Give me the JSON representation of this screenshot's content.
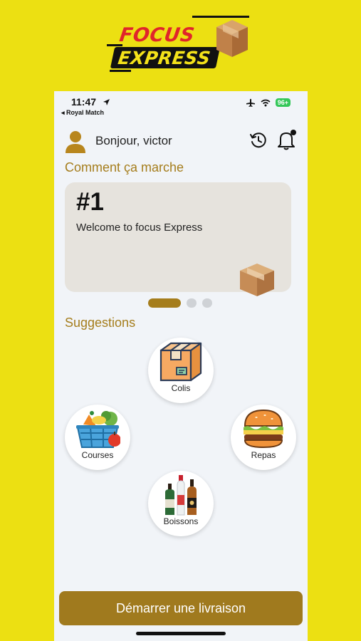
{
  "logo": {
    "line1": "FOCUS",
    "line2": "EXPRESS"
  },
  "status_bar": {
    "time": "11:47",
    "back_app": "◂ Royal Match",
    "battery": "96+"
  },
  "header": {
    "greeting": "Bonjour, victor",
    "icons": [
      "user-avatar-icon",
      "history-icon",
      "notification-bell-icon"
    ]
  },
  "how_it_works": {
    "title": "Comment ça marche",
    "card": {
      "number": "#1",
      "text": "Welcome to focus Express",
      "icon": "package-box-icon"
    },
    "pagination": {
      "pages": 3,
      "active": 0
    }
  },
  "suggestions": {
    "title": "Suggestions",
    "items": [
      {
        "label": "Colis",
        "icon": "package-icon"
      },
      {
        "label": "Courses",
        "icon": "grocery-basket-icon"
      },
      {
        "label": "Repas",
        "icon": "burger-icon"
      },
      {
        "label": "Boissons",
        "icon": "bottles-icon"
      }
    ]
  },
  "cta": {
    "label": "Démarrer une livraison"
  },
  "colors": {
    "page_bg": "#ece012",
    "accent": "#a07a1e",
    "title": "#a57d1c",
    "screen_bg": "#f1f4f8"
  }
}
